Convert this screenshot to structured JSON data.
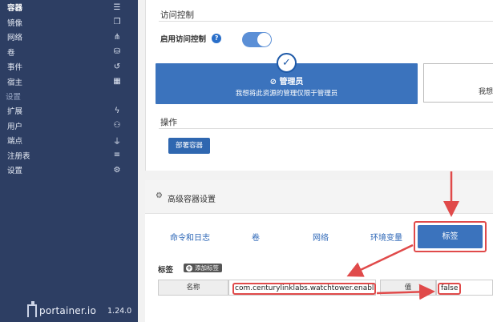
{
  "sidebar": {
    "items": [
      {
        "label": "容器",
        "icon": "list-icon",
        "glyph": "☰",
        "active": true
      },
      {
        "label": "镜像",
        "icon": "clone-icon",
        "glyph": "❐"
      },
      {
        "label": "网络",
        "icon": "sitemap-icon",
        "glyph": "⋔"
      },
      {
        "label": "卷",
        "icon": "cubes-icon",
        "glyph": "⛁"
      },
      {
        "label": "事件",
        "icon": "history-icon",
        "glyph": "↺"
      },
      {
        "label": "宿主",
        "icon": "th-icon",
        "glyph": "▦"
      }
    ],
    "settings_section": "设置",
    "settings_items": [
      {
        "label": "扩展",
        "icon": "bolt-icon",
        "glyph": "ϟ"
      },
      {
        "label": "用户",
        "icon": "users-icon",
        "glyph": "⚇"
      },
      {
        "label": "端点",
        "icon": "plug-icon",
        "glyph": "⏚"
      },
      {
        "label": "注册表",
        "icon": "database-icon",
        "glyph": "≡"
      },
      {
        "label": "设置",
        "icon": "cogs-icon",
        "glyph": "⚙"
      }
    ],
    "logo_text": "portainer.io",
    "version": "1.24.0"
  },
  "access_control": {
    "title": "访问控制",
    "enable_label": "启用访问控制",
    "help_glyph": "?",
    "toggle_on": true,
    "admin_option": {
      "title": "管理员",
      "desc": "我想将此资源的管理仅限于管理员"
    },
    "restricted_option_partial": "我想"
  },
  "actions": {
    "title": "操作",
    "deploy_button": "部署容器"
  },
  "advanced": {
    "title": "高级容器设置",
    "tabs": [
      "命令和日志",
      "卷",
      "网络",
      "环境变量",
      "标签"
    ],
    "active_tab": "标签",
    "labels": {
      "title": "标签",
      "add_button": "添加标签",
      "name_label": "名称",
      "name_value": "com.centurylinklabs.watchtower.enabl",
      "value_label": "值",
      "value_value": "false"
    }
  },
  "colors": {
    "sidebar_bg": "#2d3e63",
    "primary": "#3b73bd",
    "annotation_red": "#e04a4a"
  }
}
